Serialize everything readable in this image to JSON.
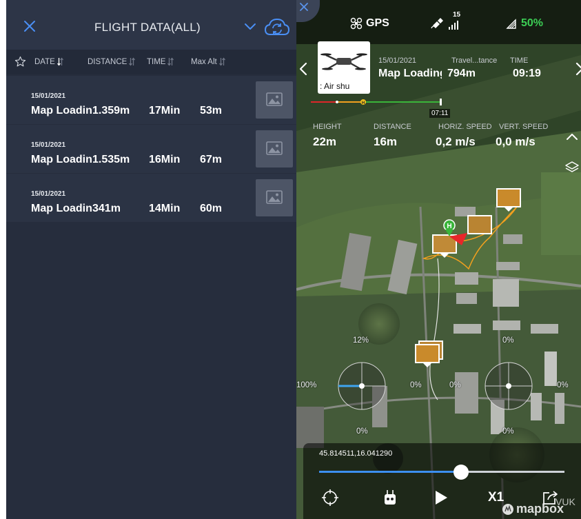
{
  "list_panel": {
    "title": "FLIGHT DATA(ALL)",
    "columns": {
      "date": "DATE",
      "distance": "DISTANCE",
      "time": "TIME",
      "max_alt": "Max Alt"
    },
    "rows": [
      {
        "date": "15/01/2021",
        "name": "Map Loading",
        "distance": "1.359m",
        "time": "17Min",
        "max_alt": "53m"
      },
      {
        "date": "15/01/2021",
        "name": "Map Loading",
        "distance": "1.535m",
        "time": "16Min",
        "max_alt": "67m"
      },
      {
        "date": "15/01/2021",
        "name": "Map Loading",
        "distance": "341m",
        "time": "14Min",
        "max_alt": "60m"
      }
    ]
  },
  "status_bar": {
    "gps_label": "GPS",
    "satellites": "15",
    "battery": "50%"
  },
  "flight_card": {
    "aircraft_label": ": Air     shu",
    "date": "15/01/2021",
    "name": "Map Loading",
    "travel_distance_label": "Travel...tance",
    "travel_distance": "794m",
    "time_label": "TIME",
    "time": "09:19"
  },
  "timeline": {
    "marker_letter": "H",
    "current_time": "07:11"
  },
  "telemetry": {
    "height_label": "HEIGHT",
    "height": "22m",
    "distance_label": "DISTANCE",
    "distance": "16m",
    "horiz_speed_label": "HORIZ. SPEED",
    "horiz_speed": "0,2 m/s",
    "vert_speed_label": "VERT. SPEED",
    "vert_speed": "0,0 m/s"
  },
  "sticks": {
    "left_top": "12%",
    "left_left": "100%",
    "left_right": "0%",
    "left_bottom": "0%",
    "right_top": "0%",
    "right_left": "0%",
    "right_right": "0%",
    "right_bottom": "0%"
  },
  "playback": {
    "coordinates": "45.814511,16.041290",
    "progress": 0.58,
    "speed": "X1"
  },
  "map": {
    "home_marker": "H",
    "attribution": "mapbox",
    "corner_label": "VUK"
  },
  "colors": {
    "accent": "#4a8ff5",
    "battery_ok": "#3ccf55",
    "drone_red": "#e8262a",
    "home_green": "#3ab53a",
    "path_orange": "#f2a01e"
  }
}
